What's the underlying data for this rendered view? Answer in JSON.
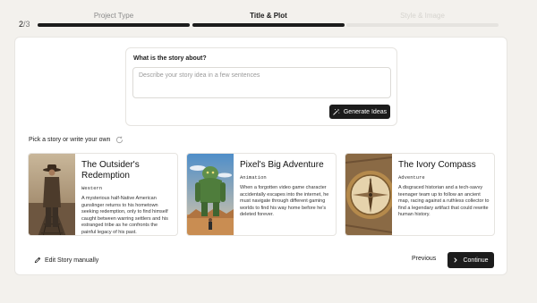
{
  "progress": {
    "current": "2",
    "total": "/3",
    "steps": [
      {
        "label": "Project Type",
        "state": "done"
      },
      {
        "label": "Title & Plot",
        "state": "active"
      },
      {
        "label": "Style & Image",
        "state": "todo"
      }
    ]
  },
  "story_prompt": {
    "question": "What is the story about?",
    "placeholder": "Describe your story idea in a few sentences",
    "value": "",
    "generate_label": "Generate Ideas"
  },
  "pick_label": "Pick a story or write your own",
  "cards": [
    {
      "title": "The Outsider's Redemption",
      "genre": "Western",
      "description": "A mysterious half-Native American gunslinger returns to his hometown seeking redemption, only to find himself caught between warring settlers and his estranged tribe as he confronts the painful legacy of his past."
    },
    {
      "title": "Pixel's Big Adventure",
      "genre": "Animation",
      "description": "When a forgotten video game character accidentally escapes into the internet, he must navigate through different gaming worlds to find his way home before he's deleted forever."
    },
    {
      "title": "The Ivory Compass",
      "genre": "Adventure",
      "description": "A disgraced historian and a tech-savvy teenager team up to follow an ancient map, racing against a ruthless collector to find a legendary artifact that could rewrite human history."
    }
  ],
  "footer": {
    "edit_label": "Edit Story manually",
    "previous_label": "Previous",
    "continue_label": "Continue"
  },
  "colors": {
    "accent": "#1c1c1c",
    "background": "#f3f1ed",
    "track": "#e5e3df"
  },
  "icons": [
    "magic-wand-icon",
    "refresh-icon",
    "pencil-icon",
    "chevron-right-icon"
  ]
}
